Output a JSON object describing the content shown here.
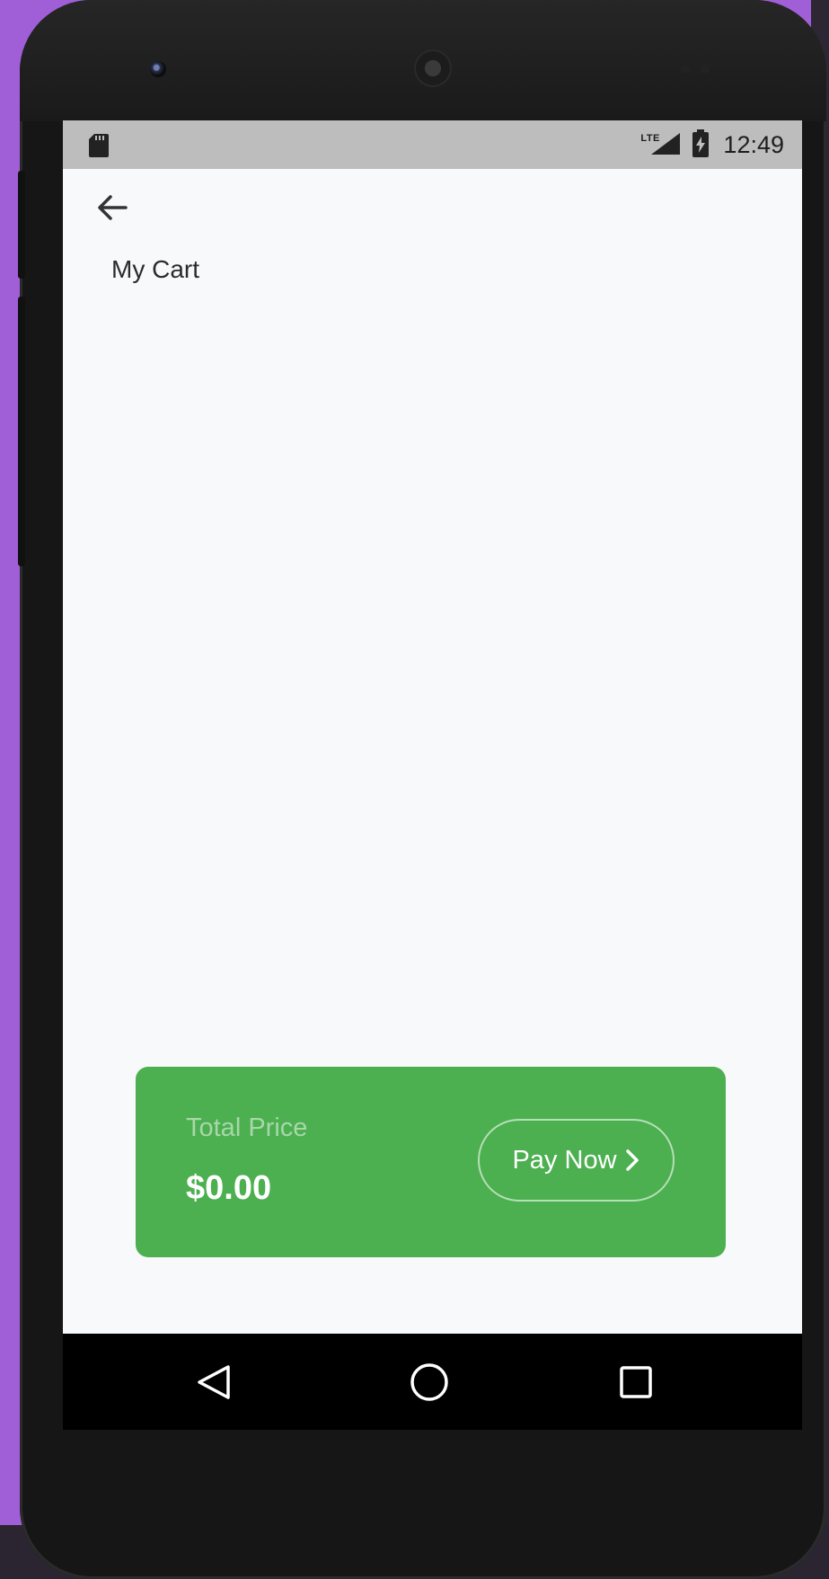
{
  "status_bar": {
    "network_label": "LTE",
    "time": "12:49",
    "icons": [
      "sd-card-icon",
      "lte-signal-icon",
      "battery-charging-icon"
    ]
  },
  "header": {
    "back_icon": "arrow-left-icon",
    "title": "My Cart"
  },
  "summary": {
    "total_label": "Total Price",
    "total_value": "$0.00",
    "pay_label": "Pay Now",
    "pay_icon": "chevron-right-icon"
  },
  "nav_bar": {
    "items": [
      "back-triangle-icon",
      "home-circle-icon",
      "recents-square-icon"
    ]
  },
  "colors": {
    "accent_green": "#4caf50",
    "total_label": "#a7d8a9",
    "status_bar": "#bdbdbd",
    "screen_bg": "#f8f9fa",
    "desktop_bg": "#a05fd6"
  }
}
